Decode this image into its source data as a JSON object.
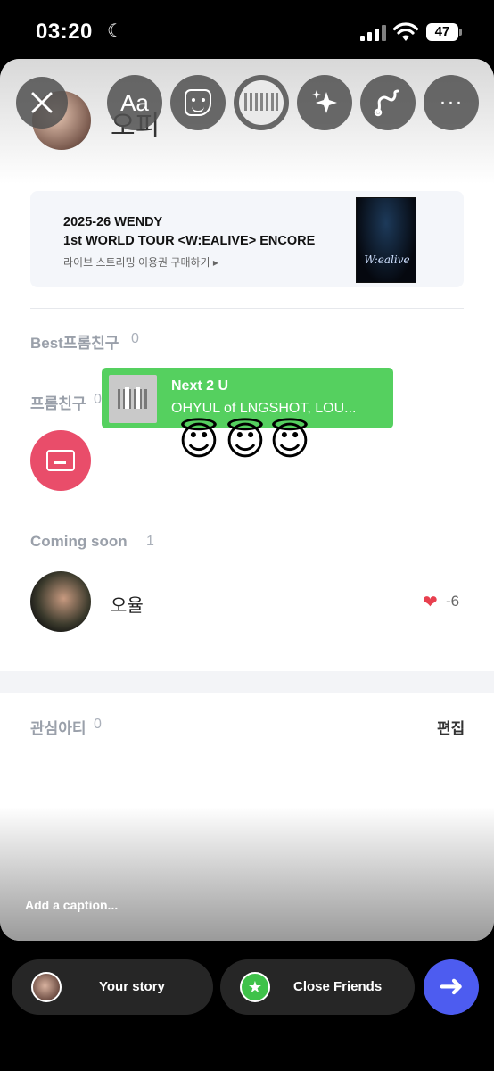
{
  "status_bar": {
    "time": "03:20",
    "battery": "47"
  },
  "toolbar": {
    "text_tool_label": "Aa",
    "more_label": "···"
  },
  "profile": {
    "name": "오피"
  },
  "banner": {
    "line1": "2025-26 WENDY",
    "line2": "1st WORLD TOUR <W:EALIVE> ENCORE",
    "line3": "라이브 스트리밍 이용권 구매하기 ▸",
    "poster_text": "W:ealive"
  },
  "sections": {
    "best": {
      "label": "Best프롬친구",
      "count": "0"
    },
    "friends": {
      "label": "프롬친구",
      "count": "0"
    },
    "coming_soon": {
      "label": "Coming soon",
      "count": "1"
    },
    "interest": {
      "label": "관심아티",
      "count": "0",
      "edit": "편집"
    }
  },
  "music_sticker": {
    "title": "Next 2 U",
    "artist": "OHYUL of LNGSHOT, LOU..."
  },
  "emoji_row": [
    "😇",
    "😇",
    "😇"
  ],
  "coming_user": {
    "name": "오율",
    "heart_count": "-6"
  },
  "caption_placeholder": "Add a caption...",
  "share": {
    "your_story": "Your story",
    "close_friends": "Close Friends"
  },
  "colors": {
    "accent_blue": "#4d5cf0",
    "music_green": "#55d05f",
    "card_pink": "#e94d6a",
    "close_friends_green": "#3fc24a"
  }
}
